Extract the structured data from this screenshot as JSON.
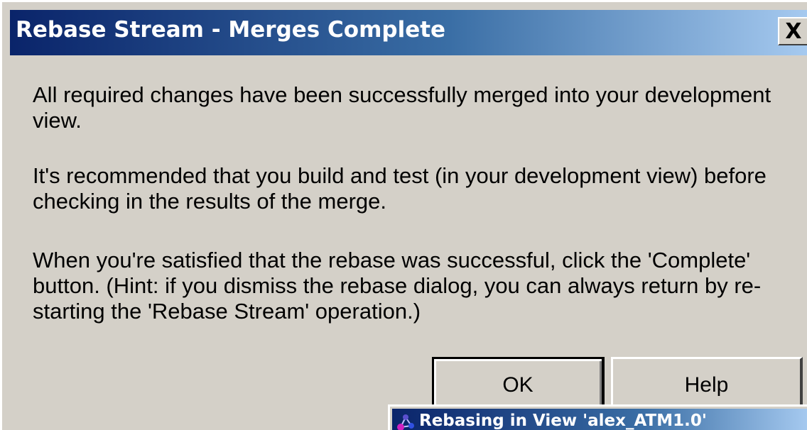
{
  "dialog": {
    "title": "Rebase Stream - Merges Complete",
    "close_label": "X",
    "messages": [
      "All required changes have been successfully merged into your development view.",
      "It's recommended that you build and test (in your development view) before checking in the results of the merge.",
      "When you're satisfied that the rebase was successful, click the 'Complete' button.   (Hint: if you dismiss the rebase dialog, you can always return by re-starting the  'Rebase Stream' operation.)"
    ],
    "buttons": {
      "ok_label": "OK",
      "help_label": "Help"
    }
  },
  "background_window": {
    "title": "Rebasing in View 'alex_ATM1.0'",
    "icon": "clearcase-icon"
  },
  "colors": {
    "titlebar_start": "#0a246a",
    "titlebar_end": "#a6caf0",
    "face": "#d4d0c8"
  }
}
